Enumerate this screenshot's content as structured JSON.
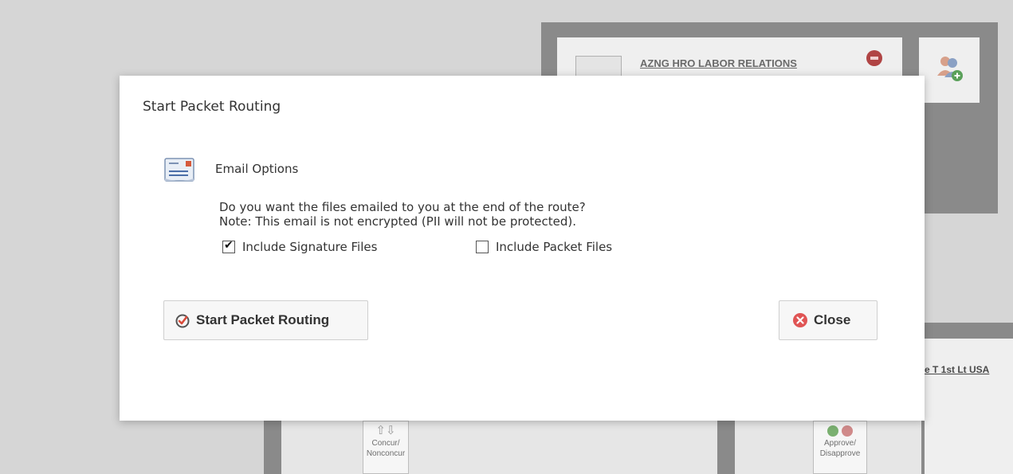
{
  "background": {
    "office_name": "AZNG HRO LABOR RELATIONS",
    "signer_name": "e T 1st Lt USA",
    "actions": [
      {
        "label_line1": "Concur/",
        "label_line2": "Nonconcur"
      },
      {
        "label_line1": "Approve/",
        "label_line2": "Disapprove"
      }
    ]
  },
  "modal": {
    "title": "Start Packet Routing",
    "section_title": "Email Options",
    "question": "Do you want the files emailed to you at the end of the route?",
    "note": "Note: This email is not encrypted (PII will not be protected).",
    "options": [
      {
        "label": "Include Signature Files",
        "checked": true
      },
      {
        "label": "Include Packet Files",
        "checked": false
      }
    ],
    "start_button": "Start Packet Routing",
    "close_button": "Close"
  },
  "colors": {
    "backdrop": "#d6d6d6",
    "panel": "#8a8a8a",
    "close_icon": "#e05555",
    "start_icon": "#d94b3a"
  }
}
